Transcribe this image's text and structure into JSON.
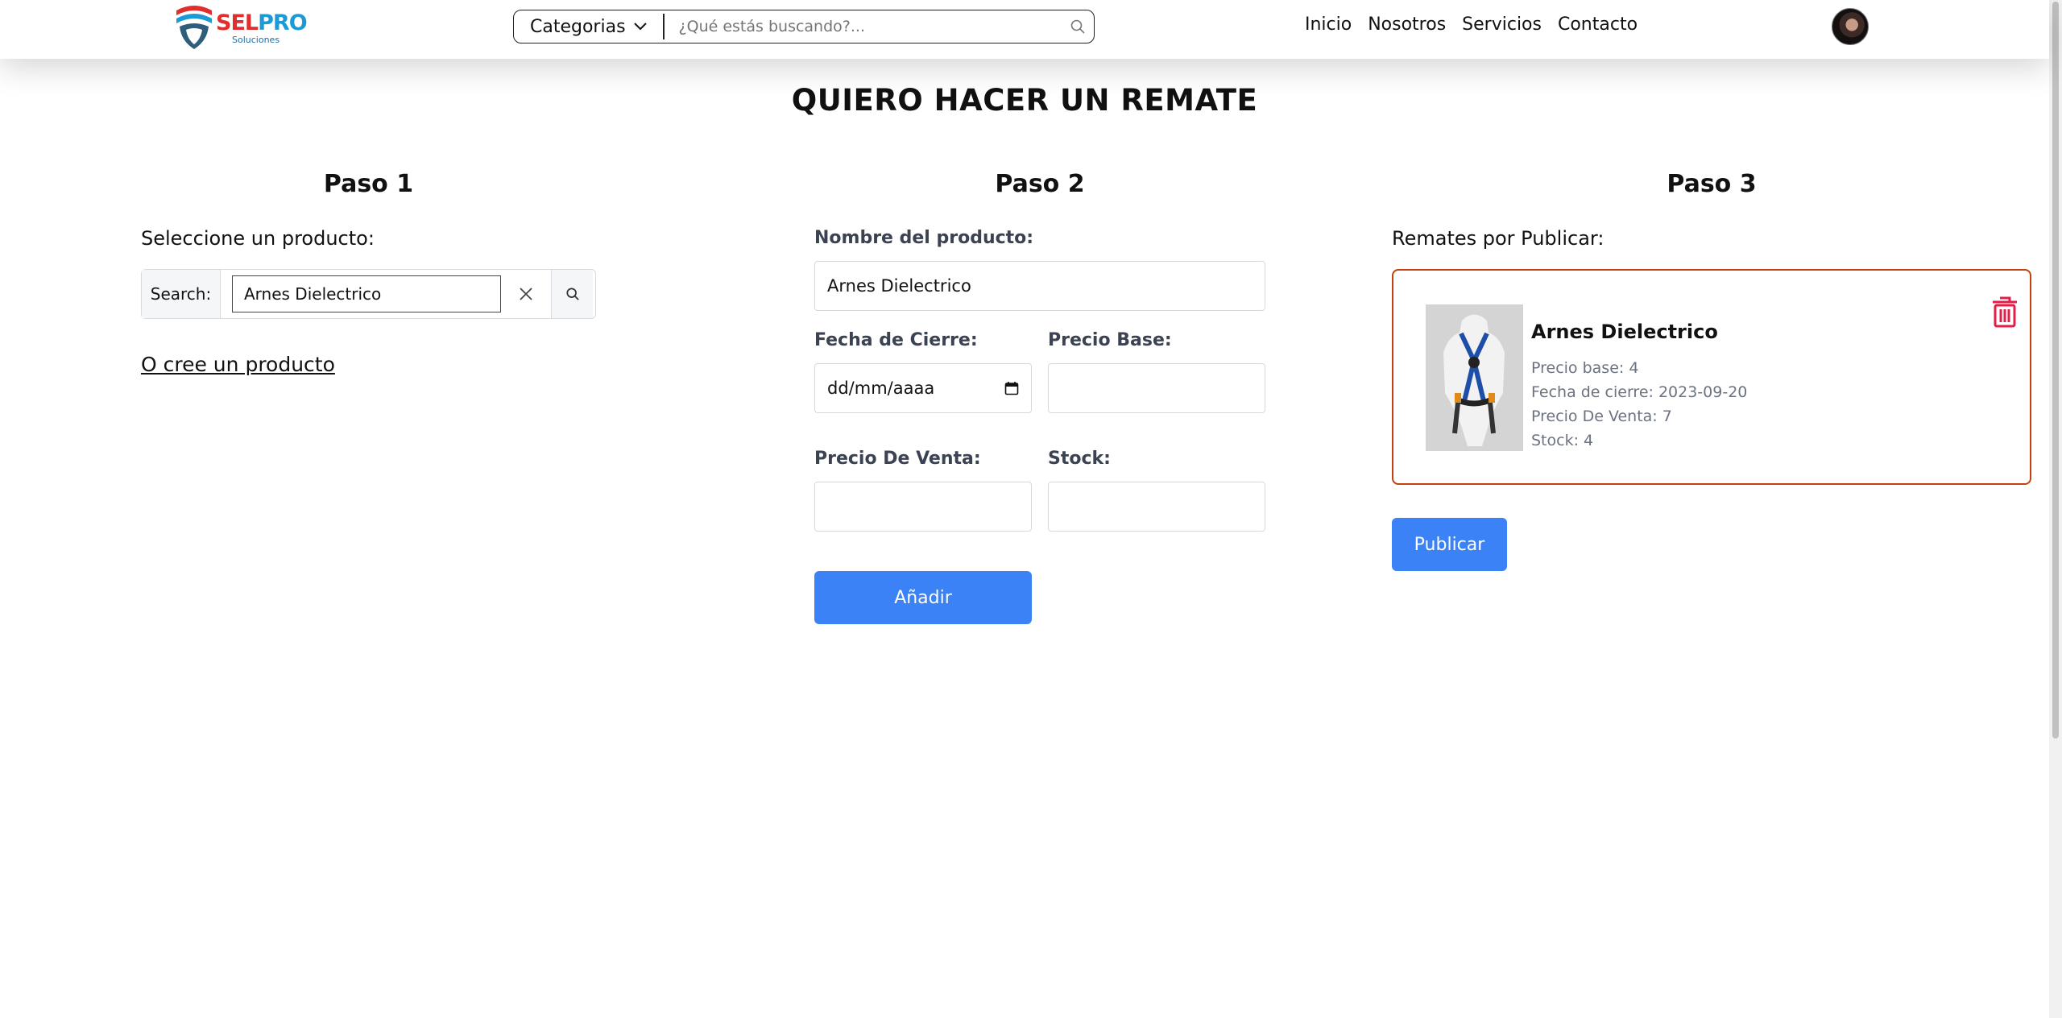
{
  "brand": {
    "name_part1": "SEL",
    "name_part2": "PRO",
    "subtitle": "Soluciones"
  },
  "header": {
    "categories_label": "Categorias",
    "search_placeholder": "¿Qué estás buscando?...",
    "nav": [
      "Inicio",
      "Nosotros",
      "Servicios",
      "Contacto"
    ]
  },
  "page_title": "QUIERO HACER UN REMATE",
  "step1": {
    "title": "Paso 1",
    "prompt": "Seleccione un producto:",
    "search_label": "Search:",
    "search_value": "Arnes Dielectrico",
    "create_link": "O cree un producto"
  },
  "step2": {
    "title": "Paso 2",
    "product_name_label": "Nombre del producto:",
    "product_name_value": "Arnes Dielectrico",
    "close_date_label": "Fecha de Cierre:",
    "close_date_placeholder": "dd/mm/aaaa",
    "base_price_label": "Precio Base:",
    "sale_price_label": "Precio De Venta:",
    "stock_label": "Stock:",
    "add_button": "Añadir"
  },
  "step3": {
    "title": "Paso 3",
    "list_label": "Remates por Publicar:",
    "card": {
      "name": "Arnes Dielectrico",
      "base_price": "Precio base: 4",
      "close_date": "Fecha de cierre: 2023-09-20",
      "sale_price": "Precio De Venta: 7",
      "stock": "Stock: 4"
    },
    "publish_button": "Publicar"
  },
  "colors": {
    "accent": "#3b82f6",
    "card_border": "#c2410c",
    "delete": "#e11d48"
  }
}
